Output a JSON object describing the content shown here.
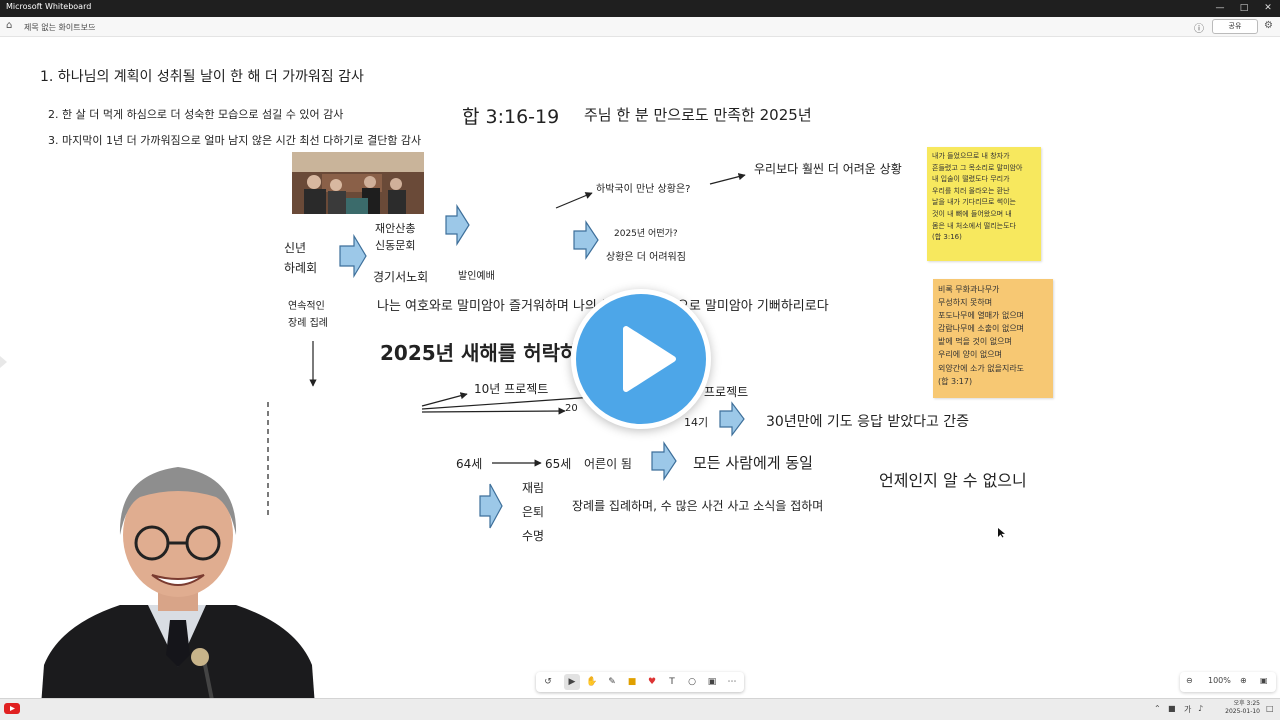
{
  "window": {
    "title": "Microsoft Whiteboard",
    "board_name": "제목 없는 화이트보드",
    "share_label": "공유"
  },
  "board": {
    "list_item_1": "1. 하나님의 계획이 성취될 날이 한 해 더 가까워짐 감사",
    "list_item_2": "2. 한 살 더 먹게 하심으로 더 성숙한 모습으로 섬길 수 있어 감사",
    "list_item_3": "3. 마지막이 1년 더 가까워짐으로 얼마 남지 않은 시간 최선 다하기로 결단함 감사",
    "verse_ref": "합 3:16-19",
    "theme": "주님 한 분 만으로도 만족한 2025년",
    "new_year_meeting": "신년\n하례회",
    "jaean": "재안산총\n신동문회",
    "gyeonggi": "경기서노회",
    "opening_worship": "발인예배",
    "continuous_funeral": "연속적인\n장례 집례",
    "habakkuk_situation": "하박국이 만난 상황은?",
    "harder_situation": "우리보다 훨씬 더 어려운 상황",
    "year_2025_how": "2025년 어떤가?",
    "harder_now": "상황은 더 어려워짐",
    "rejoice_line": "나는 여호와로 말미암아 즐거워하며 나의 구원의 하나님으로 말미암아 기뻐하리로다",
    "heading_reasons": "2025년 새해를 허락하신 이유 3가지",
    "project_10": "10년 프로젝트",
    "project_20_label": "20",
    "project_right": "프로젝트",
    "period_14": "14기",
    "answered_prayer": "30년만에 기도 응답 받았다고 간증",
    "age_64": "64세",
    "age_65": "65세",
    "become_elder": "어른이 됨",
    "same_for_all": "모든 사람에게 동일",
    "unknown_when": "언제인지 알 수 없으니",
    "sixfold": "재림\n은퇴\n수명",
    "funeral_news": "장례를 집례하며, 수 많은 사건 사고 소식을 접하며"
  },
  "stickies": {
    "yellow": "내가 들었으므로 내 창자가\n흔들렸고 그 목소리로 말미암아\n내 입술이 떨렸도다 무리가\n우리를 치러 올라오는 환난\n날을 내가 기다리므로 썩이는\n것이 내 뼈에 들어왔으며 내\n몸은 내 처소에서 떨리는도다\n(합 3:16)",
    "orange": "비록 무화과나무가\n무성하지 못하며\n포도나무에 열매가 없으며\n감람나무에 소출이 없으며\n밭에 먹을 것이 없으며\n우리에 양이 없으며\n외양간에 소가 없을지라도\n(합 3:17)"
  },
  "zoom": {
    "level": "100%"
  },
  "clock": {
    "time": "오후 3:25",
    "date": "2025-01-10"
  },
  "colors": {
    "arrow_fill": "#9cc8e8",
    "arrow_stroke": "#3d6f9a",
    "sticky_yellow": "#f7e85e",
    "sticky_orange": "#f7c873",
    "play_blue": "#4da6e8"
  }
}
